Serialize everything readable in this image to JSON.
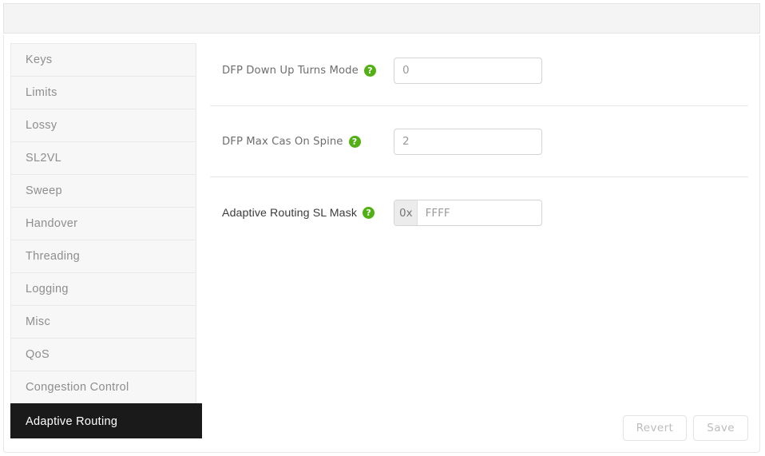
{
  "topbar": {
    "content": ""
  },
  "sidebar": {
    "items": [
      {
        "label": "Keys",
        "active": false
      },
      {
        "label": "Limits",
        "active": false
      },
      {
        "label": "Lossy",
        "active": false
      },
      {
        "label": "SL2VL",
        "active": false
      },
      {
        "label": "Sweep",
        "active": false
      },
      {
        "label": "Handover",
        "active": false
      },
      {
        "label": "Threading",
        "active": false
      },
      {
        "label": "Logging",
        "active": false
      },
      {
        "label": "Misc",
        "active": false
      },
      {
        "label": "QoS",
        "active": false
      },
      {
        "label": "Congestion Control",
        "active": false
      },
      {
        "label": "Adaptive Routing",
        "active": true
      }
    ]
  },
  "form": {
    "fields": [
      {
        "label": "DFP Down Up Turns Mode",
        "help_icon": "question-mark-icon",
        "value": "0",
        "placeholder": "",
        "prefix": ""
      },
      {
        "label": "DFP Max Cas On Spine",
        "help_icon": "question-mark-icon",
        "value": "2",
        "placeholder": "",
        "prefix": ""
      },
      {
        "label": "Adaptive Routing SL Mask",
        "help_icon": "question-mark-icon",
        "value": "FFFF",
        "placeholder": "FFFF",
        "prefix": "0x"
      }
    ]
  },
  "footer": {
    "revert_label": "Revert",
    "save_label": "Save"
  },
  "colors": {
    "help_icon_green": "#52b012",
    "active_item_bg": "#1a1a1a",
    "topbar_bg": "#f4f4f4",
    "sidebar_item_bg": "#f7f7f7"
  }
}
